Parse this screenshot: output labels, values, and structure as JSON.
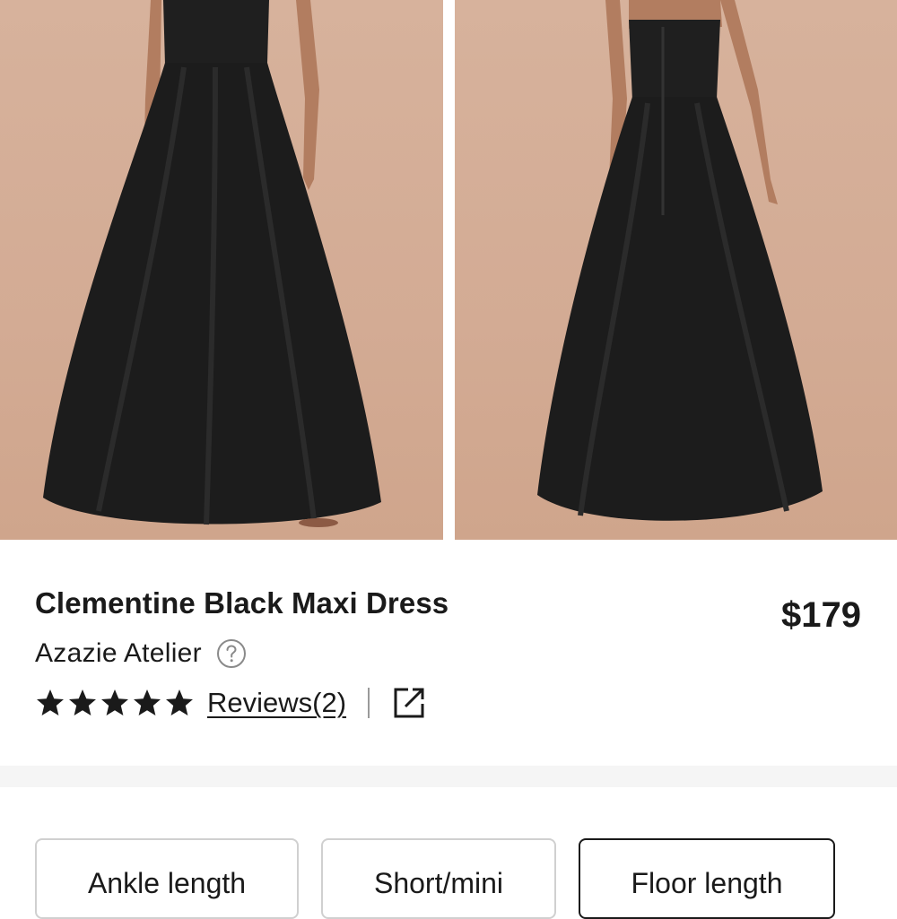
{
  "gallery": {
    "images": [
      {
        "view": "front",
        "background": "#d5ae97",
        "dress_color": "#1c1c1c"
      },
      {
        "view": "back",
        "background": "#d5ae97",
        "dress_color": "#1c1c1c"
      }
    ]
  },
  "product": {
    "title": "Clementine Black Maxi Dress",
    "price": "$179",
    "brand": "Azazie Atelier",
    "rating_stars": 5,
    "reviews_label": "Reviews(2)"
  },
  "icons": {
    "help": "question-circle",
    "star": "star-filled",
    "share": "external-link"
  },
  "length_options": {
    "items": [
      {
        "label": "Ankle length",
        "selected": false
      },
      {
        "label": "Short/mini",
        "selected": false
      },
      {
        "label": "Floor length",
        "selected": true
      }
    ]
  },
  "colors": {
    "text": "#1a1a1a",
    "border": "#d0d0d0",
    "selected_border": "#1a1a1a",
    "section_gap": "#f5f5f5"
  }
}
